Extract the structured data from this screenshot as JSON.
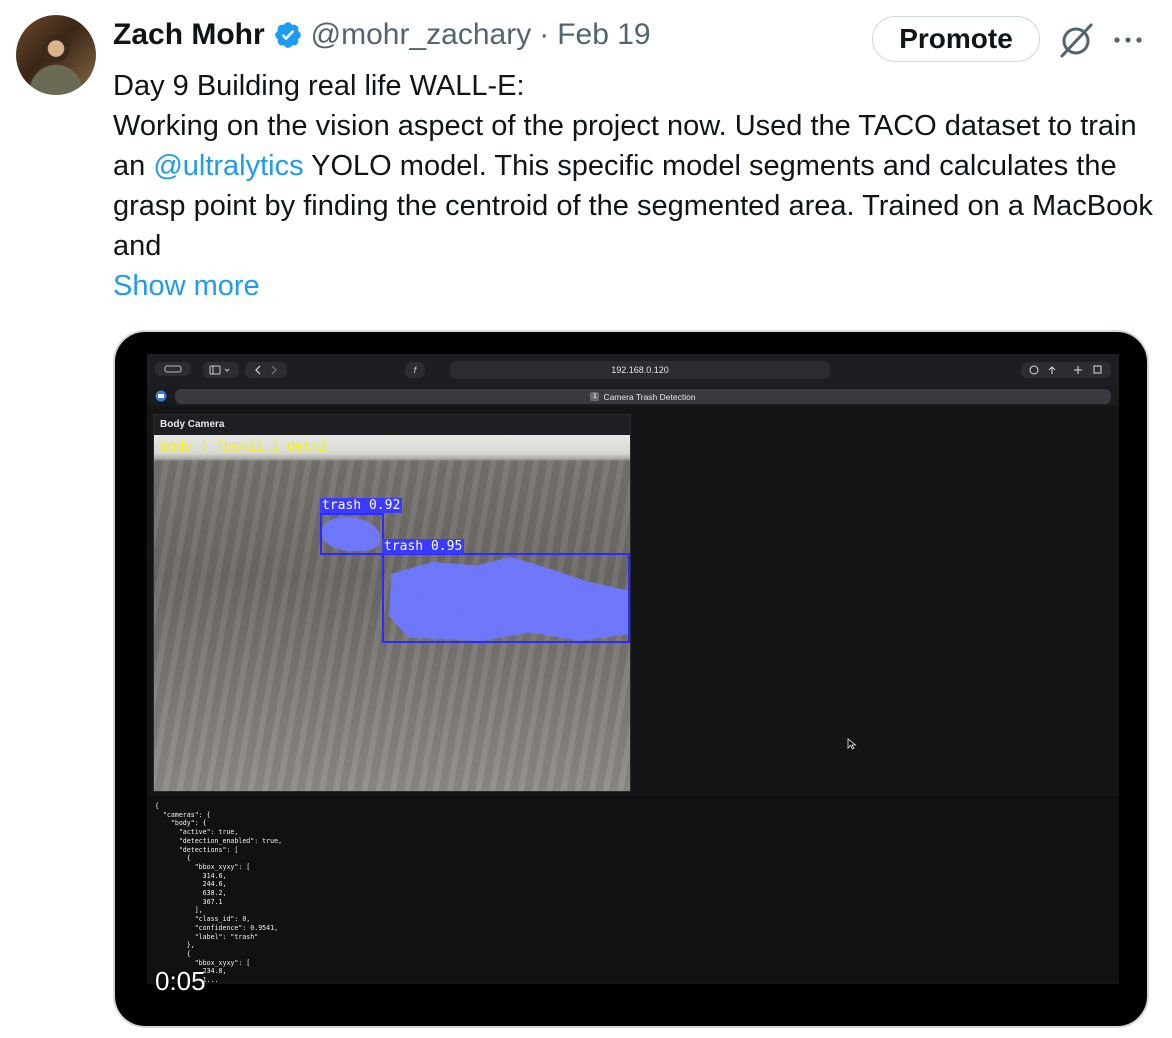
{
  "author": {
    "name": "Zach Mohr",
    "handle": "@mohr_zachary",
    "separator": "·",
    "date": "Feb 19"
  },
  "actions": {
    "promote_label": "Promote",
    "grok_icon": "grok-icon",
    "more_icon": "more-icon"
  },
  "tweet": {
    "line1": "Day 9 Building real life WALL-E:",
    "line2_before": "Working on the vision aspect of the project now. Used the TACO dataset to train an ",
    "mention": "@ultralytics",
    "line2_after": " YOLO model. This specific model segments and calculates the grasp point by finding the centroid of the segmented area. Trained on a MacBook and",
    "show_more": "Show more"
  },
  "video": {
    "timestamp": "0:05",
    "browser": {
      "url": "192.168.0.120",
      "tab_number": "1",
      "tab_title": "Camera Trash Detection"
    },
    "panel_title": "Body Camera",
    "overlay": "body | fps=11.1  det=2",
    "detections": [
      {
        "label": "trash 0.92"
      },
      {
        "label": "trash 0.95"
      }
    ],
    "json_text": "{\n  \"cameras\": {\n    \"body\": {\n      \"active\": true,\n      \"detection_enabled\": true,\n      \"detections\": [\n        {\n          \"bbox_xyxy\": [\n            314.6,\n            244.6,\n            638.2,\n            367.1\n          ],\n          \"class_id\": 0,\n          \"confidence\": 0.9541,\n          \"label\": \"trash\"\n        },\n        {\n          \"bbox_xyxy\": [\n            234.8,\n            1..."
  },
  "colors": {
    "link": "#1d9bf0",
    "secondary_text": "#536471",
    "detection_box": "#2b2bff",
    "overlay_text": "#f5f500"
  }
}
